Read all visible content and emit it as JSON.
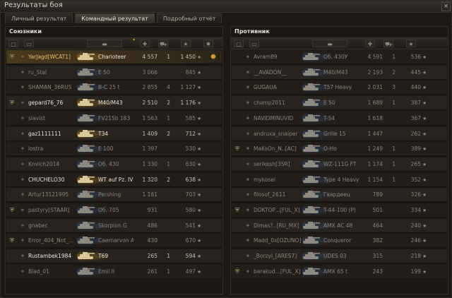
{
  "window": {
    "title": "Результаты боя",
    "close_glyph": "×"
  },
  "tabs": [
    {
      "label": "Личный результат",
      "active": false
    },
    {
      "label": "Командный результат",
      "active": true
    },
    {
      "label": "Подробный отчёт",
      "active": false
    }
  ],
  "allies": {
    "title": "Союзники",
    "header_icons": [
      "badge-icon",
      "player-icon",
      "tank-icon",
      "damage-icon",
      "kills-icon",
      "experience-icon",
      "medal-icon"
    ],
    "sort_arrow": "▾",
    "rows": [
      {
        "clan_icon": true,
        "player": "YarJagd[WCAT1]",
        "vehicle": "Charioteer",
        "damage": "4 557",
        "kills": "1",
        "xp": "1 450",
        "medal": true,
        "highlight": "me",
        "alive": true
      },
      {
        "clan_icon": false,
        "player": "ru_Stal",
        "vehicle": "E 50",
        "damage": "3 066",
        "kills": "",
        "xp": "845",
        "medal": false,
        "highlight": "",
        "alive": false
      },
      {
        "clan_icon": false,
        "player": "SHAMAN_36RUS",
        "vehicle": "B-C 25 t",
        "damage": "2 855",
        "kills": "4",
        "xp": "1 127",
        "medal": false,
        "highlight": "",
        "alive": false
      },
      {
        "clan_icon": true,
        "player": "gepard76_76",
        "vehicle": "M40/M43",
        "damage": "2 510",
        "kills": "2",
        "xp": "1 176",
        "medal": false,
        "highlight": "",
        "alive": true
      },
      {
        "clan_icon": false,
        "player": "slavist",
        "vehicle": "FV215b 183",
        "damage": "1 563",
        "kills": "1",
        "xp": "585",
        "medal": false,
        "highlight": "",
        "alive": false
      },
      {
        "clan_icon": false,
        "player": "gaz1111111",
        "vehicle": "T34",
        "damage": "1 409",
        "kills": "2",
        "xp": "712",
        "medal": false,
        "highlight": "",
        "alive": true
      },
      {
        "clan_icon": false,
        "player": "lostra",
        "vehicle": "E 100",
        "damage": "1 397",
        "kills": "",
        "xp": "530",
        "medal": false,
        "highlight": "",
        "alive": false
      },
      {
        "clan_icon": false,
        "player": "Knvich2014",
        "vehicle": "Об. 430",
        "damage": "1 330",
        "kills": "1",
        "xp": "630",
        "medal": false,
        "highlight": "",
        "alive": false
      },
      {
        "clan_icon": false,
        "player": "CHUCHELO30",
        "vehicle": "WT auf Pz. IV",
        "damage": "1 320",
        "kills": "2",
        "xp": "638",
        "medal": false,
        "highlight": "",
        "alive": true
      },
      {
        "clan_icon": false,
        "player": "Artur13121995",
        "vehicle": "Pershing",
        "damage": "1 161",
        "kills": "",
        "xp": "703",
        "medal": false,
        "highlight": "",
        "alive": false
      },
      {
        "clan_icon": true,
        "player": "pastyry[STAAR]",
        "vehicle": "Об. 705",
        "damage": "931",
        "kills": "",
        "xp": "580",
        "medal": false,
        "highlight": "",
        "alive": false
      },
      {
        "clan_icon": false,
        "player": "gnabec",
        "vehicle": "Skorpion G",
        "damage": "486",
        "kills": "",
        "xp": "541",
        "medal": false,
        "highlight": "",
        "alive": false
      },
      {
        "clan_icon": true,
        "player": "Error_404_Not_...",
        "vehicle": "Caernarvon A",
        "damage": "430",
        "kills": "",
        "xp": "670",
        "medal": false,
        "highlight": "",
        "alive": false
      },
      {
        "clan_icon": false,
        "player": "Rustambek1984",
        "vehicle": "T69",
        "damage": "265",
        "kills": "1",
        "xp": "594",
        "medal": false,
        "highlight": "",
        "alive": true
      },
      {
        "clan_icon": false,
        "player": "Blad_01",
        "vehicle": "Emil II",
        "damage": "261",
        "kills": "1",
        "xp": "497",
        "medal": false,
        "highlight": "",
        "alive": false
      }
    ]
  },
  "enemies": {
    "title": "Противник",
    "header_icons": [
      "badge-icon",
      "player-icon",
      "tank-icon",
      "damage-icon",
      "kills-icon",
      "experience-icon"
    ],
    "rows": [
      {
        "clan_icon": false,
        "player": "Avram89",
        "vehicle": "Об. 430У",
        "damage": "4 591",
        "kills": "1",
        "xp": "536",
        "alive": false
      },
      {
        "clan_icon": false,
        "player": "__AVADON__",
        "vehicle": "M40/M43",
        "damage": "2 193",
        "kills": "2",
        "xp": "445",
        "alive": false
      },
      {
        "clan_icon": false,
        "player": "GUGAUA",
        "vehicle": "T57 Heavy",
        "damage": "2 031",
        "kills": "3",
        "xp": "440",
        "alive": false
      },
      {
        "clan_icon": false,
        "player": "champ2011",
        "vehicle": "E 50",
        "damage": "1 689",
        "kills": "1",
        "xp": "387",
        "alive": false
      },
      {
        "clan_icon": false,
        "player": "NAVIDMINUVID",
        "vehicle": "T-54",
        "damage": "1 618",
        "kills": "",
        "xp": "367",
        "alive": false
      },
      {
        "clan_icon": false,
        "player": "andruxa_snaiper",
        "vehicle": "Grille 15",
        "damage": "1 447",
        "kills": "",
        "xp": "262",
        "alive": false
      },
      {
        "clan_icon": true,
        "player": "MaKsOn_N..[AC]",
        "vehicle": "О-Но",
        "damage": "1 249",
        "kills": "1",
        "xp": "389",
        "alive": false
      },
      {
        "clan_icon": false,
        "player": "serikesh[35R]",
        "vehicle": "WZ-111G FT",
        "damage": "1 174",
        "kills": "1",
        "xp": "265",
        "alive": false
      },
      {
        "clan_icon": false,
        "player": "mykosei",
        "vehicle": "Type 4 Heavy",
        "damage": "1 154",
        "kills": "1",
        "xp": "352",
        "alive": false
      },
      {
        "clan_icon": false,
        "player": "filosof_2611",
        "vehicle": "Гвардеец",
        "damage": "789",
        "kills": "",
        "xp": "326",
        "alive": false
      },
      {
        "clan_icon": true,
        "player": "DOKTOP...[FUL_X]",
        "vehicle": "T-44-100 (P)",
        "damage": "501",
        "kills": "",
        "xp": "334",
        "alive": false
      },
      {
        "clan_icon": false,
        "player": "Dimas?..[RU_MX]",
        "vehicle": "AMX AC 48",
        "damage": "464",
        "kills": "",
        "xp": "240",
        "alive": false
      },
      {
        "clan_icon": false,
        "player": "Madd_0x[OZUNO]",
        "vehicle": "Conqueror",
        "damage": "382",
        "kills": "",
        "xp": "246",
        "alive": false
      },
      {
        "clan_icon": false,
        "player": "_Borzyi_[ARES7]",
        "vehicle": "UDES 03",
        "damage": "315",
        "kills": "",
        "xp": "218",
        "alive": false
      },
      {
        "clan_icon": true,
        "player": "barakud...[FUL_X]",
        "vehicle": "AMX 65 t",
        "damage": "243",
        "kills": "",
        "xp": "199",
        "alive": false
      }
    ]
  },
  "colors": {
    "accent": "#d6a838",
    "me_row": "#4a3a1c",
    "dead_text": "#8a8477",
    "alive_text": "#e8e4da"
  },
  "icons": {
    "star": "★",
    "medal": "✹",
    "clan": "⛨",
    "tank": "tank-silhouette"
  }
}
